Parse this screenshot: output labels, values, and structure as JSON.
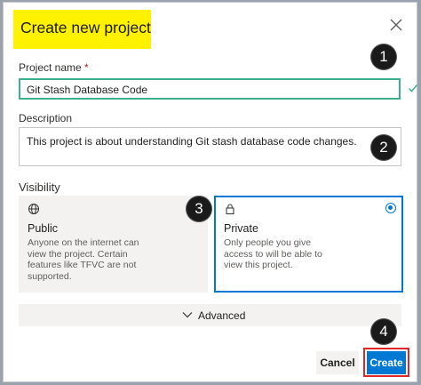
{
  "dialog": {
    "title": "Create new project",
    "close_icon": "close-icon"
  },
  "project_name": {
    "label": "Project name",
    "required_marker": "*",
    "value": "Git Stash Database Code",
    "valid_icon": "checkmark-icon"
  },
  "description": {
    "label": "Description",
    "value": "This project is about understanding Git stash database code changes."
  },
  "visibility": {
    "label": "Visibility",
    "options": [
      {
        "icon": "globe-icon",
        "title": "Public",
        "description_lines": [
          "Anyone on the internet can",
          "view the project. Certain",
          "features like TFVC are not",
          "supported."
        ],
        "selected": false
      },
      {
        "icon": "lock-icon",
        "title": "Private",
        "description_lines": [
          "Only people you give",
          "access to will be able to",
          "view this project."
        ],
        "selected": true
      }
    ]
  },
  "advanced": {
    "label": "Advanced",
    "icon": "chevron-down-icon"
  },
  "buttons": {
    "cancel": "Cancel",
    "create": "Create"
  },
  "annotations": [
    "1",
    "2",
    "3",
    "4"
  ],
  "colors": {
    "accent": "#0078d4",
    "valid_border": "#3cb08f",
    "highlight_yellow": "#fff200",
    "annotation_outline": "#e0282a"
  }
}
